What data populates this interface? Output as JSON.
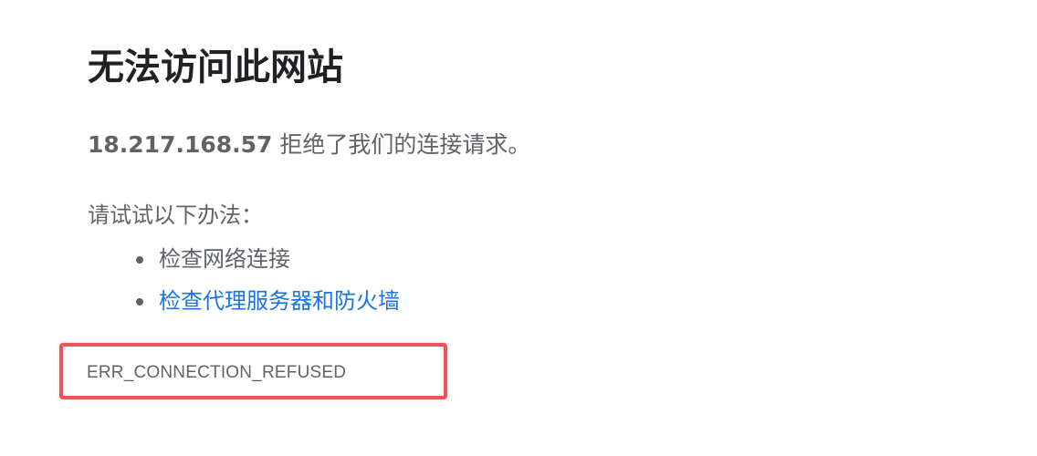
{
  "error_page": {
    "title": "无法访问此网站",
    "host": "18.217.168.57",
    "refused_message": " 拒绝了我们的连接请求。",
    "suggestions_heading": "请试试以下办法：",
    "suggestions": [
      {
        "label": "检查网络连接",
        "is_link": false
      },
      {
        "label": "检查代理服务器和防火墙",
        "is_link": true
      }
    ],
    "error_code": "ERR_CONNECTION_REFUSED"
  },
  "colors": {
    "title": "#202124",
    "body_text": "#5f6368",
    "link": "#1a73e8",
    "highlight_box": "#f0525a"
  }
}
